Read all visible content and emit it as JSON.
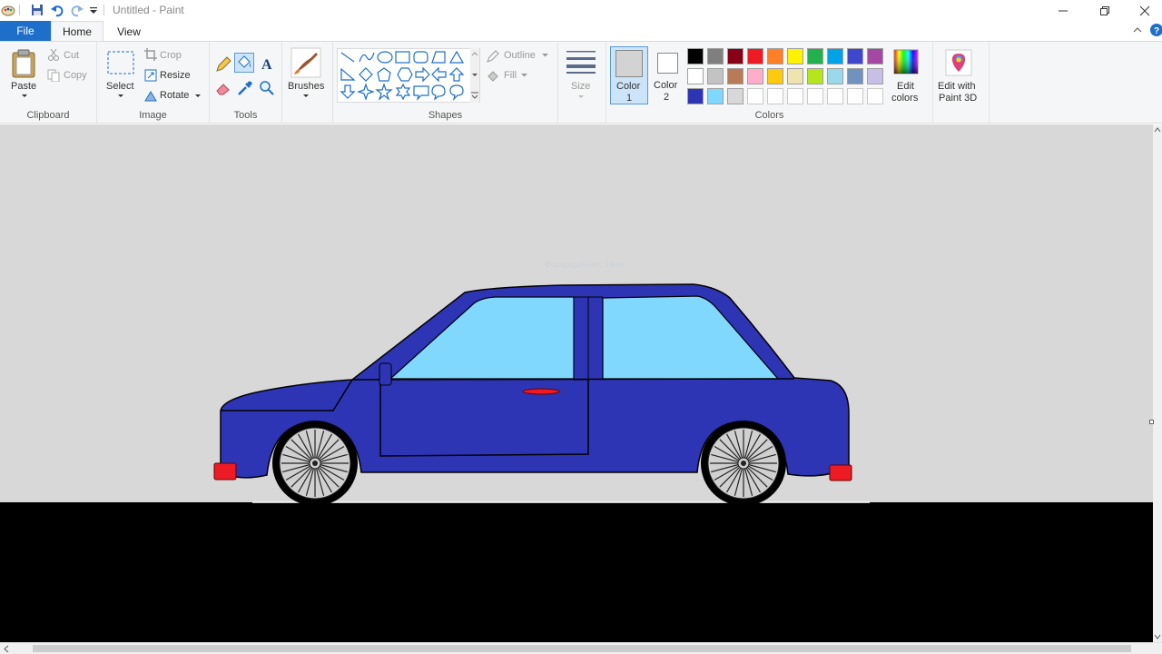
{
  "window": {
    "title": "Untitled - Paint"
  },
  "tabs": {
    "file": "File",
    "home": "Home",
    "view": "View"
  },
  "clipboard": {
    "paste": "Paste",
    "cut": "Cut",
    "copy": "Copy",
    "label": "Clipboard"
  },
  "image": {
    "select": "Select",
    "crop": "Crop",
    "resize": "Resize",
    "rotate": "Rotate",
    "label": "Image"
  },
  "tools": {
    "label": "Tools"
  },
  "brushes": {
    "label": "Brushes"
  },
  "shapes": {
    "outline": "Outline",
    "fill": "Fill",
    "label": "Shapes"
  },
  "size": {
    "label": "Size"
  },
  "colors": {
    "color1_line1": "Color",
    "color1_line2": "1",
    "color2_line1": "Color",
    "color2_line2": "2",
    "edit_line1": "Edit",
    "edit_line2": "colors",
    "label": "Colors",
    "color1_value": "#d3d3d3",
    "color2_value": "#ffffff",
    "palette_row1": [
      "#000000",
      "#7f7f7f",
      "#880015",
      "#ed1c24",
      "#ff7f27",
      "#fff200",
      "#22b14c",
      "#00a2e8",
      "#3f48cc",
      "#a349a4"
    ],
    "palette_row2": [
      "#ffffff",
      "#c3c3c3",
      "#b97a57",
      "#ffaec9",
      "#ffc90e",
      "#efe4b0",
      "#b5e61d",
      "#99d9ea",
      "#7092be",
      "#c8bfe7"
    ],
    "palette_row3": [
      "#2d35b5",
      "#80d8ff",
      "#d8d8d8"
    ]
  },
  "paint3d": {
    "line1": "Edit with",
    "line2": "Paint 3D"
  },
  "canvas": {
    "background": "#d8d8d8",
    "car_body": "#2d35b5",
    "car_window": "#80d8ff",
    "light_red": "#ed1c24",
    "ground": "#000000",
    "watermark": "Воскрешение Тени"
  }
}
